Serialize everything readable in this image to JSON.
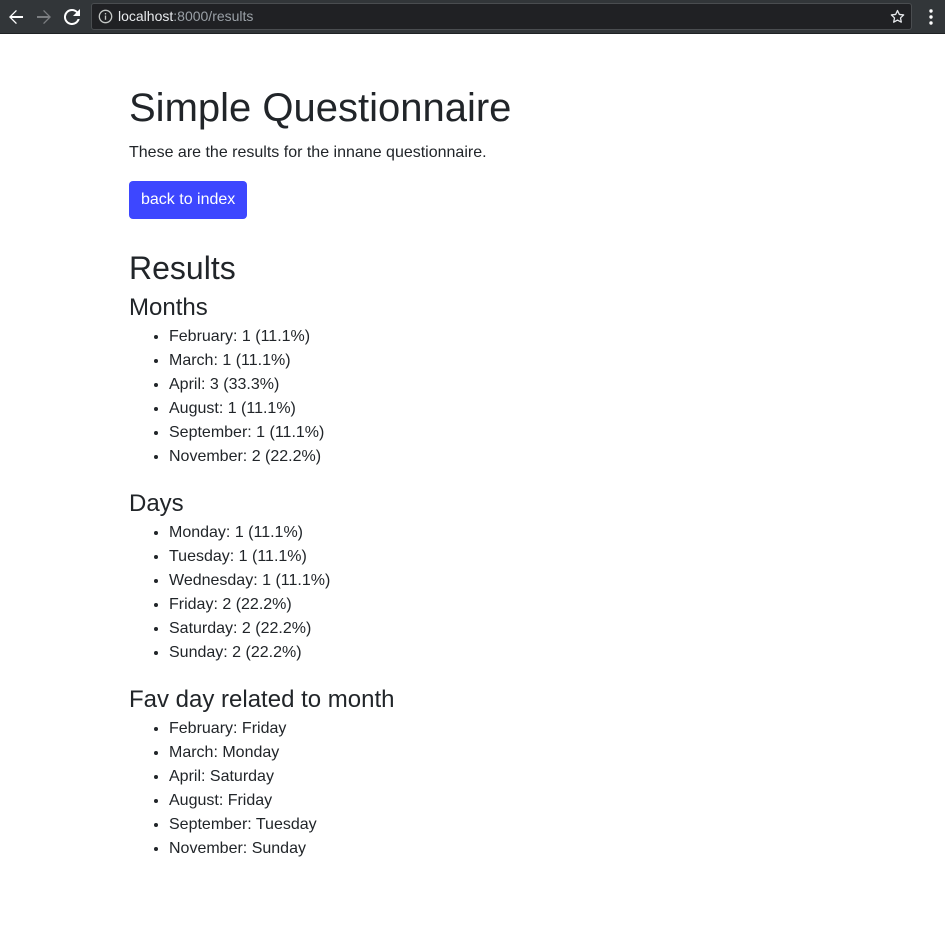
{
  "browser": {
    "url_host": "localhost",
    "url_rest": ":8000/results"
  },
  "page": {
    "title": "Simple Questionnaire",
    "lead": "These are the results for the innane questionnaire.",
    "back_button_label": "back to index",
    "results_heading": "Results"
  },
  "sections": {
    "months": {
      "heading": "Months",
      "items": [
        "February: 1 (11.1%)",
        "March: 1 (11.1%)",
        "April: 3 (33.3%)",
        "August: 1 (11.1%)",
        "September: 1 (11.1%)",
        "November: 2 (22.2%)"
      ]
    },
    "days": {
      "heading": "Days",
      "items": [
        "Monday: 1 (11.1%)",
        "Tuesday: 1 (11.1%)",
        "Wednesday: 1 (11.1%)",
        "Friday: 2 (22.2%)",
        "Saturday: 2 (22.2%)",
        "Sunday: 2 (22.2%)"
      ]
    },
    "fav": {
      "heading": "Fav day related to month",
      "items": [
        "February: Friday",
        "March: Monday",
        "April: Saturday",
        "August: Friday",
        "September: Tuesday",
        "November: Sunday"
      ]
    }
  },
  "colors": {
    "button_bg": "#3d47ff",
    "toolbar_bg": "#323639",
    "text": "#212529"
  },
  "icons": {
    "back": "arrow-left-icon",
    "forward": "arrow-right-icon",
    "reload": "reload-icon",
    "info": "info-icon",
    "bookmark": "star-icon",
    "menu": "kebab-menu-icon"
  }
}
